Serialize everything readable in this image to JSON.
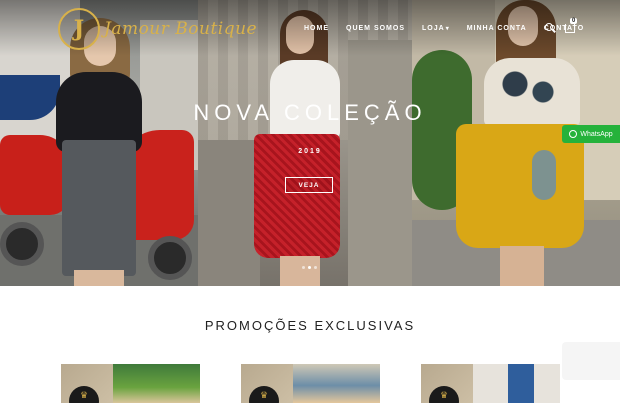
{
  "brand": {
    "logo_letter": "J",
    "name": "Jamour Boutique"
  },
  "nav": {
    "items": [
      {
        "label": "HOME"
      },
      {
        "label": "QUEM SOMOS"
      },
      {
        "label": "LOJA",
        "caret": "▾"
      },
      {
        "label": "MINHA CONTA"
      },
      {
        "label": "CONTATO"
      }
    ],
    "cart_count": "0"
  },
  "hero": {
    "title": "NOVA COLEÇÃO",
    "year": "2019",
    "button_label": "VEJA"
  },
  "whatsapp": {
    "label": "WhatsApp",
    "color": "#25b23b"
  },
  "section": {
    "title": "PROMOÇÕES EXCLUSIVAS"
  },
  "products": [
    {
      "crown": "♛"
    },
    {
      "crown": "♛"
    },
    {
      "crown": "♛"
    }
  ],
  "colors": {
    "gold": "#d8b14a"
  }
}
